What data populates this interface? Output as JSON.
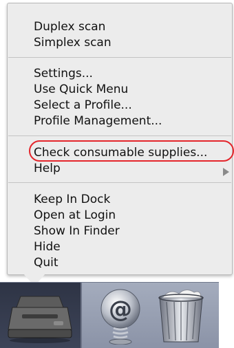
{
  "menu": {
    "items": [
      {
        "label": "Duplex scan"
      },
      {
        "label": "Simplex scan"
      },
      {
        "label": "Settings..."
      },
      {
        "label": "Use Quick Menu"
      },
      {
        "label": "Select a Profile..."
      },
      {
        "label": "Profile Management..."
      },
      {
        "label": "Check consumable supplies..."
      },
      {
        "label": "Help",
        "has_submenu": true
      },
      {
        "label": "Keep In Dock"
      },
      {
        "label": "Open at Login"
      },
      {
        "label": "Show In Finder"
      },
      {
        "label": "Hide"
      },
      {
        "label": "Quit"
      }
    ],
    "highlighted_item": "Check consumable supplies...",
    "highlight_color": "#e4252b"
  },
  "dock": {
    "items": [
      {
        "icon": "scanner-icon",
        "active": true
      },
      {
        "icon": "at-sign-icon"
      },
      {
        "icon": "trash-icon"
      }
    ]
  }
}
